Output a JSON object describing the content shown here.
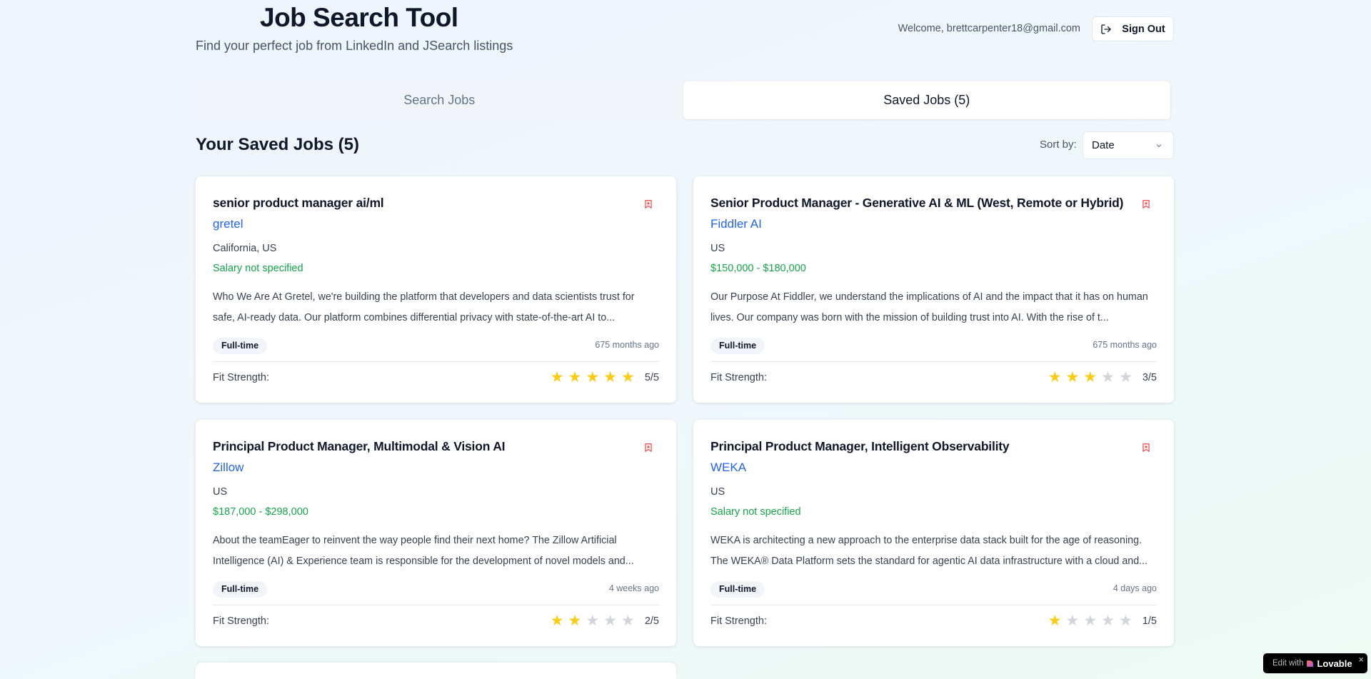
{
  "header": {
    "title": "Job Search Tool",
    "subtitle": "Find your perfect job from LinkedIn and JSearch listings",
    "welcome": "Welcome, brettcarpenter18@gmail.com",
    "sign_out": "Sign Out"
  },
  "tabs": [
    {
      "label": "Search Jobs",
      "active": false
    },
    {
      "label": "Saved Jobs (5)",
      "active": true
    }
  ],
  "saved": {
    "heading": "Your Saved Jobs (5)",
    "sort_label": "Sort by:",
    "sort_value": "Date"
  },
  "fit_label": "Fit Strength:",
  "colors": {
    "company": "#2563eb",
    "salary": "#16a34a",
    "star_on": "#facc15",
    "star_off": "#d1d5db",
    "remove": "#ef4444"
  },
  "jobs": [
    {
      "title": "senior product manager ai/ml",
      "company": "gretel",
      "location": "California, US",
      "salary": "Salary not specified",
      "description": "Who We Are At Gretel, we're building the platform that developers and data scientists trust for safe, AI-ready data. Our platform combines differential privacy with state-of-the-art AI to...",
      "type": "Full-time",
      "posted": "675 months ago",
      "fit": 5,
      "fit_text": "5/5"
    },
    {
      "title": "Senior Product Manager - Generative AI & ML (West, Remote or Hybrid)",
      "company": "Fiddler AI",
      "location": "US",
      "salary": "$150,000 - $180,000",
      "description": "Our Purpose At Fiddler, we understand the implications of AI and the impact that it has on human lives. Our company was born with the mission of building trust into AI. With the rise of t...",
      "type": "Full-time",
      "posted": "675 months ago",
      "fit": 3,
      "fit_text": "3/5"
    },
    {
      "title": "Principal Product Manager, Multimodal & Vision AI",
      "company": "Zillow",
      "location": "US",
      "salary": "$187,000 - $298,000",
      "description": "About the teamEager to reinvent the way people find their next home? The Zillow Artificial Intelligence (AI) & Experience team is responsible for the development of novel models and...",
      "type": "Full-time",
      "posted": "4 weeks ago",
      "fit": 2,
      "fit_text": "2/5"
    },
    {
      "title": "Principal Product Manager, Intelligent Observability",
      "company": "WEKA",
      "location": "US",
      "salary": "Salary not specified",
      "description": "WEKA is architecting a new approach to the enterprise data stack built for the age of reasoning. The WEKA® Data Platform sets the standard for agentic AI data infrastructure with a cloud and...",
      "type": "Full-time",
      "posted": "4 days ago",
      "fit": 1,
      "fit_text": "1/5"
    }
  ],
  "badge": {
    "prefix": "Edit with",
    "brand": "Lovable"
  }
}
